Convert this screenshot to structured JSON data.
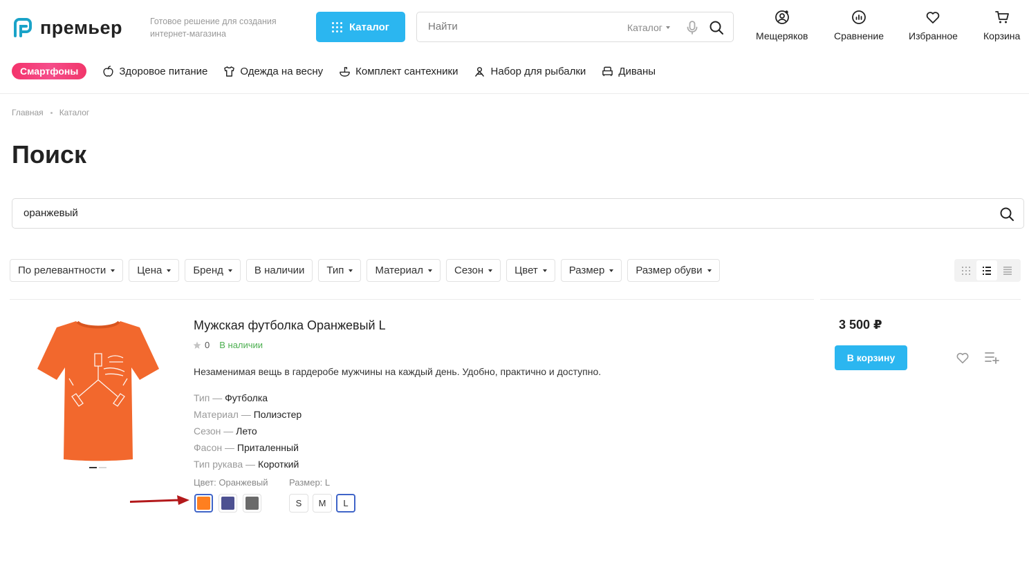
{
  "header": {
    "logo_text": "премьер",
    "tagline": "Готовое решение для создания интернет-магазина",
    "catalog_button": "Каталог",
    "search": {
      "placeholder": "Найти",
      "scope": "Каталог"
    },
    "actions": [
      {
        "label": "Мещеряков",
        "icon": "user-icon"
      },
      {
        "label": "Сравнение",
        "icon": "compare-chart-icon"
      },
      {
        "label": "Избранное",
        "icon": "heart-icon"
      },
      {
        "label": "Корзина",
        "icon": "cart-icon"
      }
    ]
  },
  "top_categories": {
    "badge": "Смартфоны",
    "items": [
      {
        "label": "Здоровое питание",
        "icon": "apple-icon"
      },
      {
        "label": "Одежда на весну",
        "icon": "shirt-icon"
      },
      {
        "label": "Комплект сантехники",
        "icon": "sink-icon"
      },
      {
        "label": "Набор для рыбалки",
        "icon": "fishing-icon"
      },
      {
        "label": "Диваны",
        "icon": "sofa-icon"
      }
    ]
  },
  "breadcrumb": [
    "Главная",
    "Каталог"
  ],
  "page_title": "Поиск",
  "search_query": "оранжевый",
  "filters": [
    {
      "label": "По релевантности",
      "dropdown": true
    },
    {
      "label": "Цена",
      "dropdown": true
    },
    {
      "label": "Бренд",
      "dropdown": true
    },
    {
      "label": "В наличии",
      "dropdown": false
    },
    {
      "label": "Тип",
      "dropdown": true
    },
    {
      "label": "Материал",
      "dropdown": true
    },
    {
      "label": "Сезон",
      "dropdown": true
    },
    {
      "label": "Цвет",
      "dropdown": true
    },
    {
      "label": "Размер",
      "dropdown": true
    },
    {
      "label": "Размер обуви",
      "dropdown": true
    }
  ],
  "view_modes": [
    "tile",
    "list",
    "table"
  ],
  "active_view": "list",
  "product": {
    "title": "Мужская футболка Оранжевый L",
    "rating": "0",
    "stock": "В наличии",
    "description": "Незаменимая вещь в гардеробе мужчины на каждый день. Удобно, практично и доступно.",
    "properties": [
      {
        "name": "Тип",
        "value": "Футболка"
      },
      {
        "name": "Материал",
        "value": "Полиэстер"
      },
      {
        "name": "Сезон",
        "value": "Лето"
      },
      {
        "name": "Фасон",
        "value": "Приталенный"
      },
      {
        "name": "Тип рукава",
        "value": "Короткий"
      }
    ],
    "color_label": "Цвет: Оранжевый",
    "colors": [
      {
        "name": "orange",
        "hex": "#ff7f1f",
        "selected": true
      },
      {
        "name": "blue",
        "hex": "#4d5191",
        "selected": false
      },
      {
        "name": "gray",
        "hex": "#6a6a6a",
        "selected": false
      }
    ],
    "size_label": "Размер: L",
    "sizes": [
      {
        "label": "S",
        "selected": false
      },
      {
        "label": "M",
        "selected": false
      },
      {
        "label": "L",
        "selected": true
      }
    ],
    "price": "3 500 ₽",
    "buy_button": "В корзину"
  },
  "colors": {
    "accent": "#2bb6f0",
    "badge_gradient": [
      "#f4336b",
      "#f54d8a"
    ],
    "stock_green": "#4caf50",
    "selected_border": "#3f64c8",
    "annotation_arrow": "#b3191b",
    "tshirt": "#f2682d"
  }
}
